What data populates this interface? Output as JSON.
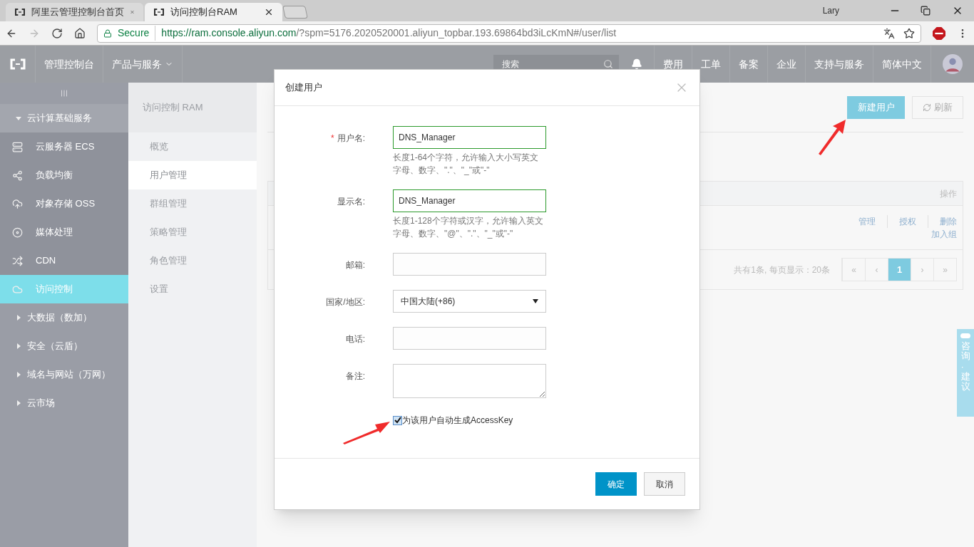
{
  "browser": {
    "tabs": [
      {
        "title": "阿里云管理控制台首页",
        "selected": false
      },
      {
        "title": "访问控制台RAM",
        "selected": true
      }
    ],
    "user": "Lary",
    "secure": "Secure",
    "url_host": "https://ram.console.aliyun.com",
    "url_path": "/?spm=5176.2020520001.aliyun_topbar.193.69864bd3iLcKmN#/user/list"
  },
  "topnav": {
    "console": "管理控制台",
    "products": "产品与服务",
    "search": {
      "placeholder": "搜索"
    },
    "links": [
      "费用",
      "工单",
      "备案",
      "企业",
      "支持与服务",
      "简体中文"
    ]
  },
  "sidebar": {
    "groups": [
      {
        "label": "云计算基础服务",
        "expanded": true,
        "children": [
          {
            "label": "云服务器 ECS",
            "selected": false
          },
          {
            "label": "负载均衡",
            "selected": false
          },
          {
            "label": "对象存储 OSS",
            "selected": false
          },
          {
            "label": "媒体处理",
            "selected": false
          },
          {
            "label": "CDN",
            "selected": false
          },
          {
            "label": "访问控制",
            "selected": true
          }
        ]
      },
      {
        "label": "大数据（数加）",
        "expanded": false
      },
      {
        "label": "安全（云盾）",
        "expanded": false
      },
      {
        "label": "域名与网站（万网）",
        "expanded": false
      },
      {
        "label": "云市场",
        "expanded": false
      }
    ]
  },
  "subnav": {
    "title": "访问控制 RAM",
    "items": [
      {
        "label": "概览",
        "selected": false
      },
      {
        "label": "用户管理",
        "selected": true
      },
      {
        "label": "群组管理",
        "selected": false
      },
      {
        "label": "策略管理",
        "selected": false
      },
      {
        "label": "角色管理",
        "selected": false
      },
      {
        "label": "设置",
        "selected": false
      }
    ]
  },
  "main": {
    "new_user": "新建用户",
    "refresh": "刷新",
    "table": {
      "action_column": "操作",
      "row_actions": [
        "管理",
        "授权",
        "删除"
      ],
      "row_extra_action": "加入组"
    },
    "pagination": {
      "summary": "共有1条, 每页显示：20条",
      "pages": [
        {
          "label": "«",
          "selected": false
        },
        {
          "label": "‹",
          "selected": false
        },
        {
          "label": "1",
          "selected": true
        },
        {
          "label": "›",
          "selected": false
        },
        {
          "label": "»",
          "selected": false
        }
      ]
    }
  },
  "modal": {
    "title": "创建用户",
    "required_mark": "*",
    "fields": [
      {
        "kind": "text",
        "label": "用户名:",
        "required": true,
        "valid": true,
        "value": "DNS_Manager",
        "hint": "长度1-64个字符，允许输入大小写英文字母、数字、\".\"、\"_\"或\"-\""
      },
      {
        "kind": "text",
        "label": "显示名:",
        "required": false,
        "valid": true,
        "value": "DNS_Manager",
        "hint": "长度1-128个字符或汉字，允许输入英文字母、数字、\"@\"、\".\"、\"_\"或\"-\""
      },
      {
        "kind": "text",
        "label": "邮箱:",
        "required": false,
        "valid": false
      },
      {
        "kind": "select",
        "label": "国家/地区:",
        "required": false,
        "valid": false,
        "value": "中国大陆(+86)"
      },
      {
        "kind": "text",
        "label": "电话:",
        "required": false,
        "valid": false
      },
      {
        "kind": "textarea",
        "label": "备注:",
        "required": false,
        "valid": false
      }
    ],
    "checkbox": {
      "label": "为该用户自动生成AccessKey",
      "checked": true
    },
    "buttons": [
      {
        "label": "确定",
        "primary": true
      },
      {
        "label": "取消",
        "primary": false
      }
    ]
  },
  "float_tab": "咨询·建议"
}
